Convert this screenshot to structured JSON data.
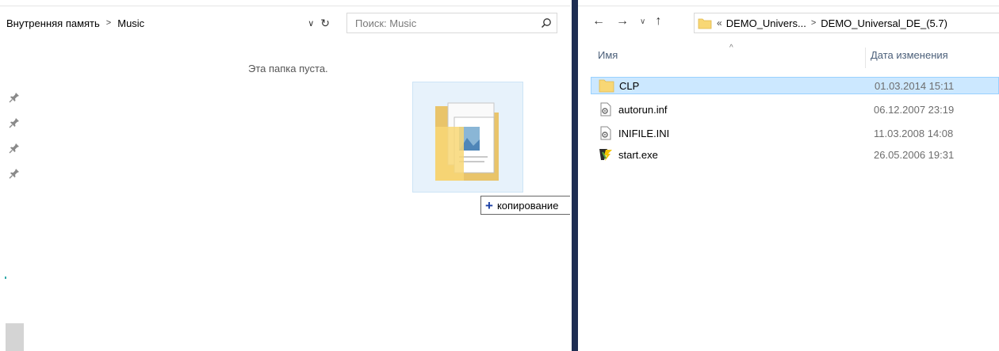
{
  "left_window": {
    "breadcrumb": [
      "Внутренняя память",
      "Music"
    ],
    "search_placeholder": "Поиск: Music",
    "empty_message": "Эта папка пуста.",
    "drag_tooltip_action": "копирование"
  },
  "right_window": {
    "breadcrumb": [
      "«",
      "DEMO_Univers...",
      "DEMO_Universal_DE_(5.7)"
    ],
    "columns": {
      "name": "Имя",
      "date": "Дата изменения"
    },
    "files": [
      {
        "name": "CLP",
        "date": "01.03.2014 15:11",
        "icon": "folder-icon",
        "selected": true
      },
      {
        "name": "autorun.inf",
        "date": "06.12.2007 23:19",
        "icon": "settings-file-icon",
        "selected": false
      },
      {
        "name": "INIFILE.INI",
        "date": "11.03.2008 14:08",
        "icon": "settings-file-icon",
        "selected": false
      },
      {
        "name": "start.exe",
        "date": "26.05.2006 19:31",
        "icon": "app-executable-icon",
        "selected": false
      }
    ]
  },
  "colors": {
    "selection_bg": "#cce8ff",
    "selection_border": "#99d1ff",
    "folder_yellow": "#f8d775",
    "divider": "#1e2d52",
    "drag_tile_bg": "#e7f2fb"
  }
}
